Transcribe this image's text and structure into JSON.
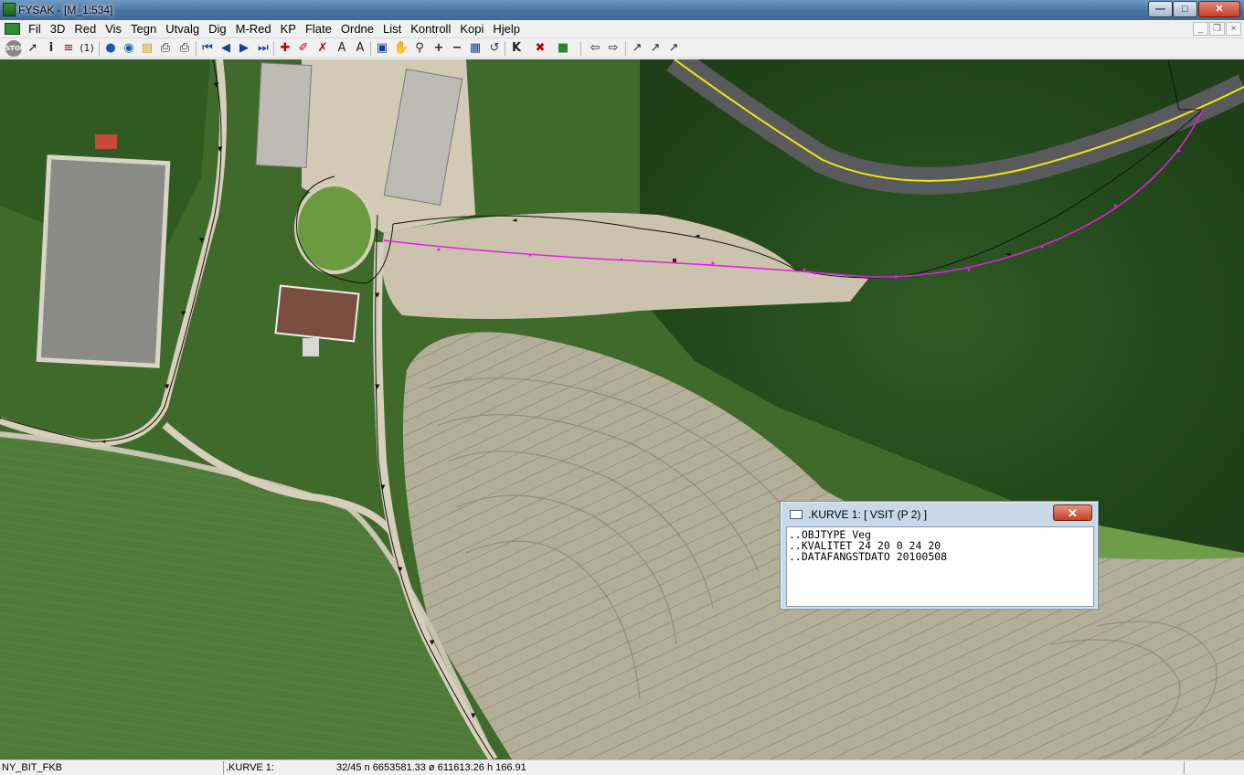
{
  "window": {
    "title": "FYSAK - [M_1:534]"
  },
  "menu": {
    "items": [
      "Fil",
      "3D",
      "Red",
      "Vis",
      "Tegn",
      "Utvalg",
      "Dig",
      "M-Red",
      "KP",
      "Flate",
      "Ordne",
      "List",
      "Kontroll",
      "Kopi",
      "Hjelp"
    ]
  },
  "toolbar": {
    "icons": [
      "stop-icon",
      "pointer-icon",
      "info-icon",
      "list-icon",
      "object-count-icon",
      "globe-icon",
      "globe-www-icon",
      "open-folder-icon",
      "print-icon",
      "print-preview-icon",
      "first-icon",
      "prev-icon",
      "next-icon",
      "last-icon",
      "add-point-icon",
      "edit-curve-icon",
      "delete-curve-icon",
      "add-text-icon",
      "text-tool-icon",
      "zoom-extent-icon",
      "pan-hand-icon",
      "zoom-icon",
      "zoom-in-icon",
      "zoom-out-icon",
      "layers-icon",
      "refresh-icon",
      "k-icon",
      "snap-icon",
      "export-icon",
      "back-icon",
      "forward-icon",
      "tool-a-icon",
      "tool-b-icon",
      "tool-c-icon"
    ]
  },
  "popup": {
    "title": ".KURVE 1:   [  VSIT (P 2) ]",
    "close": "✕",
    "lines": [
      "..OBJTYPE Veg",
      "..KVALITET 24 20 0 24 20",
      "..DATAFANGSTDATO 20100508"
    ]
  },
  "status": {
    "layer": "NY_BIT_FKB",
    "object": ".KURVE 1:",
    "coords": "32/45  n 6653581.33  ø 611613.26  h 166.91"
  },
  "colors": {
    "selected_curve": "#e81ee8",
    "road_line": "#f2e60a",
    "curve_line": "#111111"
  }
}
